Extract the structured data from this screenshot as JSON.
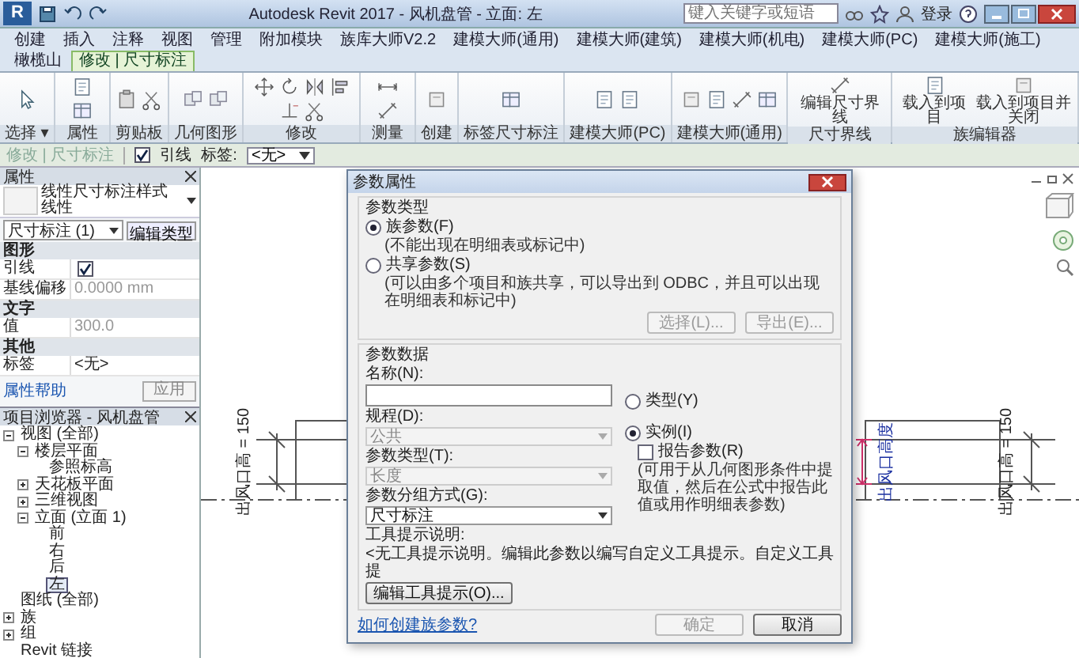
{
  "title_bar": {
    "logo": "R",
    "title": "Autodesk Revit 2017 - 风机盘管 - 立面: 左",
    "search": {
      "placeholder": "键入关键字或短语"
    },
    "user": "登录"
  },
  "tabs": [
    {
      "label": "创建",
      "selected": false
    },
    {
      "label": "插入",
      "selected": false
    },
    {
      "label": "注释",
      "selected": false
    },
    {
      "label": "视图",
      "selected": false
    },
    {
      "label": "管理",
      "selected": false
    },
    {
      "label": "附加模块",
      "selected": false
    },
    {
      "label": "族库大师V2.2",
      "selected": false
    },
    {
      "label": "建模大师(通用)",
      "selected": false
    },
    {
      "label": "建模大师(建筑)",
      "selected": false
    },
    {
      "label": "建模大师(机电)",
      "selected": false
    },
    {
      "label": "建模大师(PC)",
      "selected": false
    },
    {
      "label": "建模大师(施工)",
      "selected": false
    },
    {
      "label": "橄榄山",
      "selected": false
    },
    {
      "label": "修改 | 尺寸标注",
      "selected": true
    }
  ],
  "ribbon_panels": [
    {
      "label": "选择 ▾"
    },
    {
      "label": "属性"
    },
    {
      "label": "剪贴板"
    },
    {
      "label": "几何图形"
    },
    {
      "label": "修改"
    },
    {
      "label": "测量"
    },
    {
      "label": "创建"
    },
    {
      "label": "标签尺寸标注"
    },
    {
      "label": "建模大师(PC)"
    },
    {
      "label": "建模大师(通用)"
    },
    {
      "label": "尺寸界线",
      "tools": [
        "编辑尺寸界线"
      ]
    },
    {
      "label": "族编辑器",
      "tools": [
        "载入到项目",
        "载入到项目并关闭"
      ]
    }
  ],
  "options_bar": {
    "context": "修改 | 尺寸标注",
    "leader": {
      "label": "引线",
      "checked": true
    },
    "label_field": {
      "label": "标签:",
      "value": "<无>"
    }
  },
  "properties": {
    "title": "属性",
    "type_selector": {
      "family": "线性尺寸标注样式",
      "type": "线性"
    },
    "instance_selector": "尺寸标注 (1)",
    "edit_type": "编辑类型",
    "groups": [
      {
        "name": "图形",
        "rows": [
          {
            "kind": "checkbox",
            "label": "引线",
            "checked": true
          },
          {
            "kind": "text",
            "label": "基线偏移",
            "value": "0.0000 mm",
            "disabled": true
          }
        ]
      },
      {
        "name": "文字",
        "rows": [
          {
            "kind": "text",
            "label": "值",
            "value": "300.0",
            "disabled": true
          }
        ]
      },
      {
        "name": "其他",
        "rows": [
          {
            "kind": "text",
            "label": "标签",
            "value": "<无>",
            "disabled": false
          }
        ]
      }
    ],
    "help": "属性帮助",
    "apply": "应用"
  },
  "project_browser": {
    "title": "项目浏览器 - 风机盘管",
    "tree": [
      {
        "label": "视图 (全部)",
        "expanded": true,
        "selected": false,
        "children": [
          {
            "label": "楼层平面",
            "expanded": true,
            "selected": false,
            "children": [
              {
                "label": "参照标高",
                "selected": false
              }
            ]
          },
          {
            "label": "天花板平面",
            "expanded": false,
            "selected": false
          },
          {
            "label": "三维视图",
            "expanded": false,
            "selected": false
          },
          {
            "label": "立面 (立面 1)",
            "expanded": true,
            "selected": false,
            "children": [
              {
                "label": "前",
                "selected": false
              },
              {
                "label": "右",
                "selected": false
              },
              {
                "label": "后",
                "selected": false
              },
              {
                "label": "左",
                "selected": true
              }
            ]
          }
        ]
      },
      {
        "label": "图纸 (全部)",
        "selected": false
      },
      {
        "label": "族",
        "expanded": false,
        "selected": false
      },
      {
        "label": "组",
        "expanded": false,
        "selected": false
      },
      {
        "label": "Revit 链接",
        "selected": false
      }
    ]
  },
  "canvas": {
    "dimension_labels": [
      "出风口高 = 150",
      "出风口高 = 150"
    ],
    "active_dimension_label": "出风口高度"
  },
  "dialog": {
    "title": "参数属性",
    "parameter_type": {
      "heading": "参数类型",
      "options": [
        {
          "label": "族参数(F)",
          "note": "(不能出现在明细表或标记中)",
          "selected": true
        },
        {
          "label": "共享参数(S)",
          "note": "(可以由多个项目和族共享，可以导出到 ODBC，并且可以出现在明细表和标记中)",
          "selected": false
        }
      ],
      "buttons": [
        {
          "label": "选择(L)...",
          "disabled": true
        },
        {
          "label": "导出(E)...",
          "disabled": true
        }
      ]
    },
    "parameter_data": {
      "heading": "参数数据",
      "name": {
        "label": "名称(N):"
      },
      "fields": [
        {
          "label": "规程(D):",
          "value": "公共",
          "disabled": true
        },
        {
          "label": "参数类型(T):",
          "value": "长度",
          "disabled": true
        },
        {
          "label": "参数分组方式(G):",
          "value": "尺寸标注",
          "disabled": false
        }
      ],
      "scope": [
        {
          "label": "类型(Y)",
          "selected": false
        },
        {
          "label": "实例(I)",
          "selected": true
        }
      ],
      "report": {
        "label": "报告参数(R)",
        "checked": false,
        "note": "(可用于从几何图形条件中提取值，然后在公式中报告此值或用作明细表参数)"
      }
    },
    "tooltip": {
      "label": "工具提示说明:",
      "text": "<无工具提示说明。编辑此参数以编写自定义工具提示。自定义工具提",
      "button": "编辑工具提示(O)..."
    },
    "help_link": "如何创建族参数?",
    "buttons": [
      {
        "label": "确定",
        "disabled": true
      },
      {
        "label": "取消",
        "disabled": false
      }
    ]
  }
}
